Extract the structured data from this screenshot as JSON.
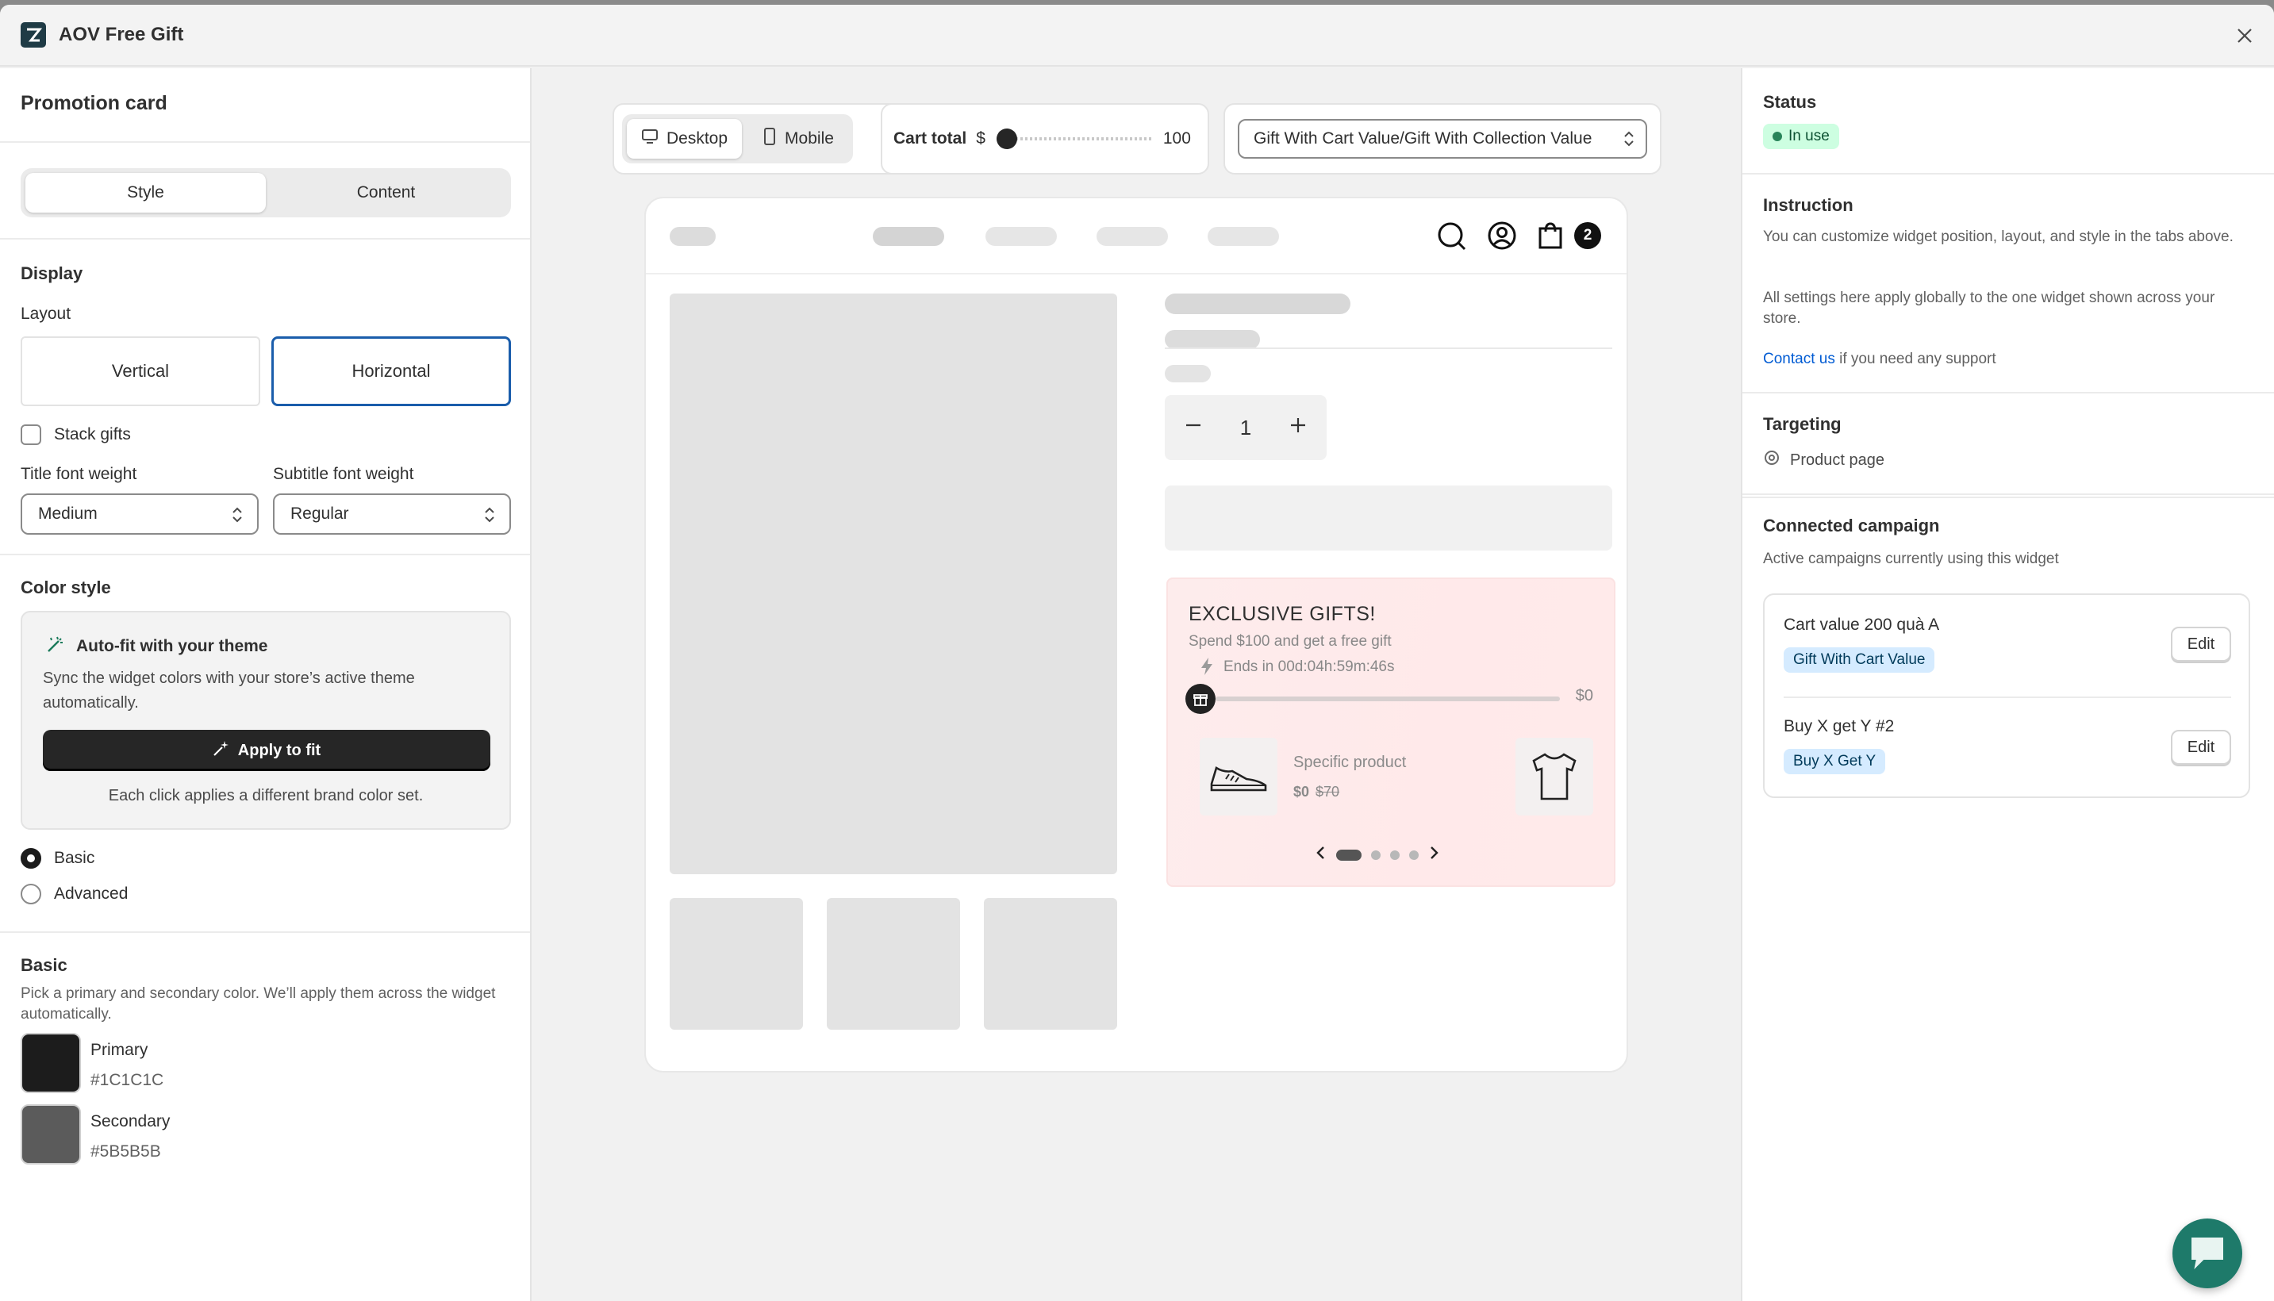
{
  "app": {
    "title": "AOV Free Gift"
  },
  "left": {
    "heading": "Promotion card",
    "tabs": [
      {
        "label": "Style",
        "active": true
      },
      {
        "label": "Content",
        "active": false
      }
    ],
    "display": {
      "heading": "Display",
      "layout_label": "Layout",
      "layout_options": [
        {
          "label": "Vertical",
          "selected": false
        },
        {
          "label": "Horizontal",
          "selected": true
        }
      ],
      "stack_gifts_label": "Stack gifts",
      "title_font_weight_label": "Title font weight",
      "title_font_weight_value": "Medium",
      "subtitle_font_weight_label": "Subtitle font weight",
      "subtitle_font_weight_value": "Regular"
    },
    "color_style": {
      "heading": "Color style",
      "autofit_title": "Auto-fit with your theme",
      "autofit_desc": "Sync the widget colors with your store’s active theme automatically.",
      "apply_button": "Apply to fit",
      "apply_hint": "Each click applies a different brand color set.",
      "options": [
        {
          "label": "Basic",
          "checked": true
        },
        {
          "label": "Advanced",
          "checked": false
        }
      ]
    },
    "basic": {
      "heading": "Basic",
      "desc": "Pick a primary and secondary color. We’ll apply them across the widget automatically.",
      "primary_label": "Primary",
      "primary_value": "#1C1C1C",
      "secondary_label": "Secondary",
      "secondary_value": "#5B5B5B"
    }
  },
  "toolbar": {
    "desktop": "Desktop",
    "mobile": "Mobile",
    "cart_total_label": "Cart total",
    "currency": "$",
    "cart_total_value": "100",
    "campaign_select": "Gift With Cart Value/Gift With Collection Value"
  },
  "preview": {
    "cart_count": "2",
    "quantity": "1",
    "promo": {
      "title": "EXCLUSIVE GIFTS!",
      "subtitle": "Spend $100 and get a free gift",
      "ends": "Ends in 00d:04h:59m:46s",
      "amount": "$0",
      "product_name": "Specific product",
      "price": "$0",
      "compare_price": "$70"
    }
  },
  "right": {
    "status": {
      "heading": "Status",
      "badge": "In use"
    },
    "instruction": {
      "heading": "Instruction",
      "p1": "You can customize widget position, layout, and style in the tabs above.",
      "p2": "All settings here apply globally to the one widget shown across your store.",
      "contact_link": "Contact us",
      "contact_rest": " if you need any support"
    },
    "targeting": {
      "heading": "Targeting",
      "item": "Product page"
    },
    "connected": {
      "heading": "Connected campaign",
      "desc": "Active campaigns currently using this widget",
      "campaigns": [
        {
          "name": "Cart value 200 quà A",
          "badge": "Gift With Cart Value",
          "edit": "Edit"
        },
        {
          "name": "Buy X get Y #2",
          "badge": "Buy X Get Y",
          "edit": "Edit"
        }
      ]
    }
  },
  "colors": {
    "accent": "#1a5dab",
    "primary_swatch": "#1C1C1C",
    "secondary_swatch": "#5B5B5B",
    "fab": "#1e7a6a"
  }
}
